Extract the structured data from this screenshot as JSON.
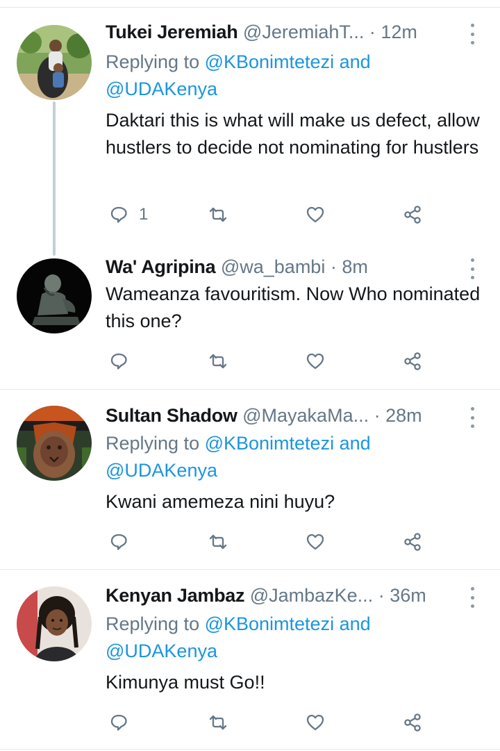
{
  "colors": {
    "accent": "#1b95e0",
    "secondary_text": "#657786",
    "divider": "#e1e8ed",
    "icon": "#657786"
  },
  "tweets": [
    {
      "name": "Tukei Jeremiah",
      "handle": "@JeremiahT...",
      "time": "· 12m",
      "replying_prefix": "Replying to ",
      "mention1": "@KBonimtetezi",
      "and": " and",
      "mention2": "@UDAKenya",
      "text": "Daktari this is what will make us defect, allow hustlers to decide not nominating for hustlers",
      "reply_count": "1",
      "avatar_icon": "avatar-man-with-child"
    },
    {
      "name": "Wa' Agripina",
      "handle": "@wa_bambi",
      "time": "· 8m",
      "text": "Wameanza favouritism. Now Who nominated this one?",
      "reply_count": "",
      "avatar_icon": "avatar-statue"
    },
    {
      "name": "Sultan Shadow",
      "handle": "@MayakaMa...",
      "time": "· 28m",
      "replying_prefix": "Replying to ",
      "mention1": "@KBonimtetezi",
      "and": " and",
      "mention2": "@UDAKenya",
      "text": "Kwani amemeza nini huyu?",
      "reply_count": "",
      "avatar_icon": "avatar-lion-tattoo"
    },
    {
      "name": "Kenyan Jambaz",
      "handle": "@JambazKe...",
      "time": "· 36m",
      "replying_prefix": "Replying to ",
      "mention1": "@KBonimtetezi",
      "and": " and",
      "mention2": "@UDAKenya",
      "text": "Kimunya must Go!!",
      "reply_count": "",
      "avatar_icon": "avatar-woman-braids"
    }
  ]
}
